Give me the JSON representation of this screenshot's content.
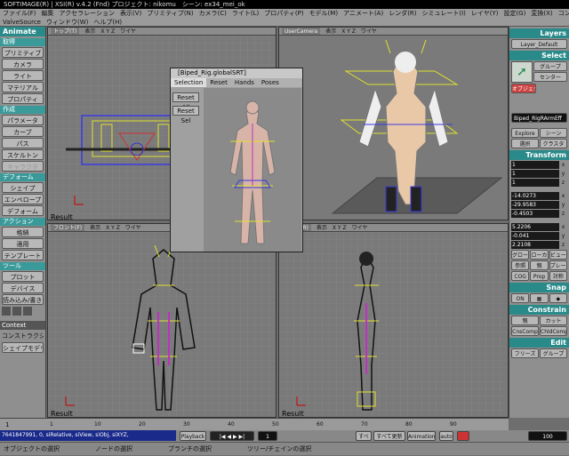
{
  "titlebar": {
    "text": "SOFTIMAGE(R) | XSI(R) v.4.2 (Fnd) プロジェクト: nikomu　シーン: ex34_mei_ok"
  },
  "menubar": {
    "row1": [
      "ファイル(F)",
      "編集",
      "アクセラレーション",
      "表示(V)",
      "プリミティブ(N)",
      "カメラ(C)",
      "ライト(L)",
      "プロパティ(P)",
      "モデル(M)",
      "アニメート(A)",
      "レンダ(R)",
      "シミュレート(I)",
      "レイヤ(Y)",
      "設定(G)",
      "変換(X)",
      "コンストレイント(R)",
      "スナップ(S)"
    ],
    "row2": [
      "ValveSource",
      "ウィンドウ(W)",
      "ヘルプ(H)"
    ]
  },
  "left": {
    "mode": "Animate",
    "sections": [
      {
        "title": "取得",
        "items": [
          "プリミティブ",
          "カメラ",
          "ライト",
          "マテリアル",
          "プロパティ"
        ]
      },
      {
        "title": "作成",
        "items": [
          "パラメータ",
          "カーブ",
          "パス",
          "スケルトン",
          "キャラクタ"
        ]
      },
      {
        "title": "デフォーム",
        "items": [
          "シェイプ",
          "エンベロープ",
          "デフォーム"
        ]
      },
      {
        "title": "アクション",
        "items": [
          "格納",
          "適用",
          "テンプレート"
        ]
      },
      {
        "title": "ツール",
        "items": [
          "プロット",
          "デバイス",
          "読み込み/書き出し"
        ]
      }
    ],
    "context": "Context",
    "context_items": [
      "コンストラクションモード",
      "シェイプモデリング"
    ]
  },
  "viewports": {
    "top": {
      "title": "トップ(T)",
      "menu": [
        "表示",
        "X Y Z",
        "ワイヤ"
      ],
      "label": "Result"
    },
    "camera": {
      "title": "UserCamera",
      "menu": [
        "表示",
        "X Y Z",
        "ワイヤ"
      ]
    },
    "front": {
      "title": "フロント(F)",
      "menu": [
        "表示",
        "X Y Z",
        "ワイヤ"
      ],
      "label": "Result"
    },
    "right": {
      "title": "ライト(R)",
      "menu": [
        "表示",
        "X Y Z",
        "ワイヤ"
      ],
      "label": "Result"
    }
  },
  "dialog": {
    "title": "[Biped_Rig.globalSRT]",
    "tabs": [
      "Selection",
      "Reset",
      "Hands",
      "Poses"
    ],
    "buttons": [
      "Reset All",
      "Reset Sel"
    ]
  },
  "right": {
    "layers_head": "Layers",
    "layer_value": "Layer_Default",
    "select_head": "Select",
    "select_btns": [
      "グループ",
      "センター",
      "オブジェクト"
    ],
    "selection_name": "Biped_RigRArmEff",
    "explore_btns": [
      "Explore",
      "シーン",
      "選択",
      "クラスタ"
    ],
    "transform_head": "Transform",
    "scale": [
      "1",
      "1",
      "1"
    ],
    "rotate": [
      "-14.0273",
      "-29.9583",
      "-0.4503"
    ],
    "translate": [
      "5.2206",
      "-0.041",
      "2.2108"
    ],
    "axes": [
      "x",
      "y",
      "z"
    ],
    "mode_btns": [
      "グローバル",
      "ローカル",
      "ビュー",
      "参照",
      "親",
      "プレーン",
      "COG",
      "Prop",
      "対称"
    ],
    "snap_head": "Snap",
    "snap_btns": [
      "ON"
    ],
    "constrain_head": "Constrain",
    "constrain_btns": [
      "親",
      "カット",
      "CnsComp",
      "ChldComp"
    ],
    "edit_head": "Edit",
    "edit_btns": [
      "フリーズ",
      "グループ"
    ]
  },
  "timeline": {
    "ticks": [
      "1",
      "10",
      "20",
      "30",
      "40",
      "50",
      "60",
      "70",
      "80",
      "90"
    ],
    "end": "100",
    "current": "1"
  },
  "cmdbar": {
    "command": "7641847991, 0, siRelative, siView, siObj, siXYZ,",
    "playback": "Playback",
    "buttons": [
      "すべて",
      "すべて更新(T)",
      "Animation",
      "auto"
    ],
    "frame": "1"
  },
  "status": [
    "オブジェクトの選択",
    "ノードの選択",
    "ブランチの選択",
    "ツリー/チェインの選択"
  ]
}
